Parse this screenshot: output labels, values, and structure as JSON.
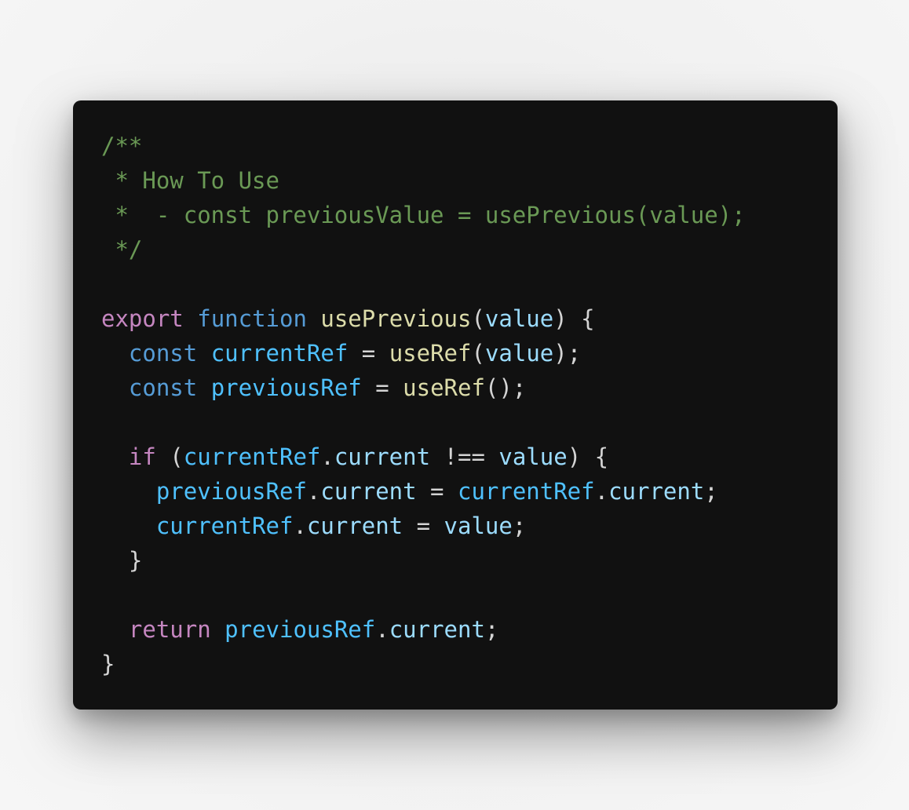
{
  "code": {
    "language": "javascript",
    "colors": {
      "background": "#111111",
      "comment": "#6a9955",
      "keyword": "#c586c0",
      "storage": "#569cd6",
      "function": "#dcdcaa",
      "parameter": "#9cdcfe",
      "variable": "#4fc1ff",
      "punctuation": "#d4d4d4"
    },
    "lines": [
      [
        {
          "t": "/**",
          "k": "comment"
        }
      ],
      [
        {
          "t": " * How To Use",
          "k": "comment"
        }
      ],
      [
        {
          "t": " *  - const previousValue = usePrevious(value);",
          "k": "comment"
        }
      ],
      [
        {
          "t": " */",
          "k": "comment"
        }
      ],
      [],
      [
        {
          "t": "export",
          "k": "keyword"
        },
        {
          "t": " ",
          "k": "punct"
        },
        {
          "t": "function",
          "k": "storage"
        },
        {
          "t": " ",
          "k": "punct"
        },
        {
          "t": "usePrevious",
          "k": "func"
        },
        {
          "t": "(",
          "k": "punct"
        },
        {
          "t": "value",
          "k": "param"
        },
        {
          "t": ") {",
          "k": "punct"
        }
      ],
      [
        {
          "t": "  ",
          "k": "punct"
        },
        {
          "t": "const",
          "k": "storage"
        },
        {
          "t": " ",
          "k": "punct"
        },
        {
          "t": "currentRef",
          "k": "var"
        },
        {
          "t": " = ",
          "k": "punct"
        },
        {
          "t": "useRef",
          "k": "func"
        },
        {
          "t": "(",
          "k": "punct"
        },
        {
          "t": "value",
          "k": "param"
        },
        {
          "t": ");",
          "k": "punct"
        }
      ],
      [
        {
          "t": "  ",
          "k": "punct"
        },
        {
          "t": "const",
          "k": "storage"
        },
        {
          "t": " ",
          "k": "punct"
        },
        {
          "t": "previousRef",
          "k": "var"
        },
        {
          "t": " = ",
          "k": "punct"
        },
        {
          "t": "useRef",
          "k": "func"
        },
        {
          "t": "();",
          "k": "punct"
        }
      ],
      [],
      [
        {
          "t": "  ",
          "k": "punct"
        },
        {
          "t": "if",
          "k": "keyword"
        },
        {
          "t": " (",
          "k": "punct"
        },
        {
          "t": "currentRef",
          "k": "var"
        },
        {
          "t": ".",
          "k": "punct"
        },
        {
          "t": "current",
          "k": "prop"
        },
        {
          "t": " !== ",
          "k": "punct"
        },
        {
          "t": "value",
          "k": "param"
        },
        {
          "t": ") {",
          "k": "punct"
        }
      ],
      [
        {
          "t": "    ",
          "k": "punct"
        },
        {
          "t": "previousRef",
          "k": "var"
        },
        {
          "t": ".",
          "k": "punct"
        },
        {
          "t": "current",
          "k": "prop"
        },
        {
          "t": " = ",
          "k": "punct"
        },
        {
          "t": "currentRef",
          "k": "var"
        },
        {
          "t": ".",
          "k": "punct"
        },
        {
          "t": "current",
          "k": "prop"
        },
        {
          "t": ";",
          "k": "punct"
        }
      ],
      [
        {
          "t": "    ",
          "k": "punct"
        },
        {
          "t": "currentRef",
          "k": "var"
        },
        {
          "t": ".",
          "k": "punct"
        },
        {
          "t": "current",
          "k": "prop"
        },
        {
          "t": " = ",
          "k": "punct"
        },
        {
          "t": "value",
          "k": "param"
        },
        {
          "t": ";",
          "k": "punct"
        }
      ],
      [
        {
          "t": "  }",
          "k": "punct"
        }
      ],
      [],
      [
        {
          "t": "  ",
          "k": "punct"
        },
        {
          "t": "return",
          "k": "keyword"
        },
        {
          "t": " ",
          "k": "punct"
        },
        {
          "t": "previousRef",
          "k": "var"
        },
        {
          "t": ".",
          "k": "punct"
        },
        {
          "t": "current",
          "k": "prop"
        },
        {
          "t": ";",
          "k": "punct"
        }
      ],
      [
        {
          "t": "}",
          "k": "punct"
        }
      ]
    ]
  }
}
